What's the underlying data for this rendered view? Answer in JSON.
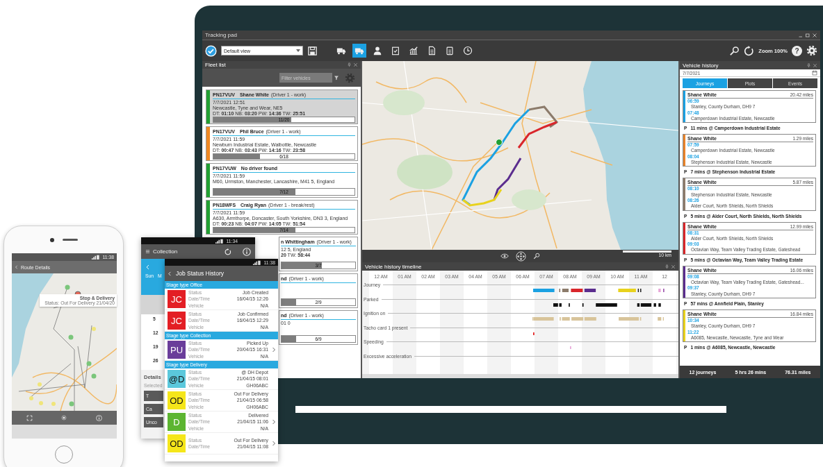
{
  "app": {
    "title": "Tracking pad",
    "view_select": "Default view",
    "zoom_label": "Zoom 100%",
    "help_label": "?",
    "toolbar_buttons": [
      {
        "selected": false
      },
      {
        "selected": true
      },
      {
        "selected": false
      },
      {
        "selected": false
      },
      {
        "selected": false
      },
      {
        "selected": false
      },
      {
        "selected": false
      },
      {
        "selected": false
      }
    ]
  },
  "fleet_list": {
    "title": "Fleet list",
    "filter_placeholder": "Filter vehicles",
    "vehicles": [
      {
        "kind": "full",
        "plate": "PN17VUV",
        "driver": "Shane White",
        "role": "(Driver 1 - work)",
        "time": "7/7/2021 12:51",
        "address": "Newcastle, Tyne and Wear, NE5",
        "stats": "DT: **01:10** NB: **03:20** PW: **14:36** TW: **25:51**",
        "progress": "11/20",
        "level": 0.55,
        "color": "#22a033",
        "selected": true
      },
      {
        "kind": "full",
        "plate": "PN17VUV",
        "driver": "Phil Bruce",
        "role": "(Driver 1 - work)",
        "time": "7/7/2021 11:59",
        "address": "Newburn Industrial Estate, Walbottle, Newcastle",
        "stats": "DT: **00:47** NB: **03:43** PW: **14:16** TW: **23:58**",
        "progress": "6/18",
        "level": 0.33,
        "color": "#f08a24",
        "selected": false
      },
      {
        "kind": "full",
        "plate": "PN17VUW",
        "driver": "No driver found",
        "time": "7/7/2021 11:59",
        "address": "M60, Urmston, Manchester, Lancashire, M41 5, England",
        "progress": "7/12",
        "level": 0.58,
        "color": "#22a033",
        "selected": false
      },
      {
        "kind": "full",
        "plate": "PN18WFS",
        "driver": "Craig Ryan",
        "role": "(Driver 1 - break/rest)",
        "time": "7/7/2021 11:59",
        "address": "A630, Armthorpe, Doncaster, South Yorkshire, DN3 3, England",
        "stats": "DT: **00:23** NB: **04:07** PW: **14:05** TW: **51:54**",
        "progress": "7/14",
        "level": 0.58,
        "color": "#22a033",
        "selected": false
      },
      {
        "kind": "partial",
        "driver": "n Whittingham",
        "role": "(Driver 1 - work)",
        "address": "12 5, England",
        "stats": "**20** TW: **58:44**",
        "progress": "3/7",
        "level": 0.55,
        "selected": false
      },
      {
        "kind": "partial",
        "driver": "nd",
        "role": "(Driver 1 - work)",
        "progress": "2/9",
        "level": 0.2,
        "selected": false
      },
      {
        "kind": "partial",
        "driver": "nd",
        "role": "(Driver 1 - work)",
        "address": "01 0",
        "progress": "6/9",
        "level": 0.2,
        "selected": false
      }
    ]
  },
  "map": {
    "scale_label": "10 km"
  },
  "timeline": {
    "title": "Vehicle history timeline",
    "hours": [
      "12 AM",
      "01 AM",
      "02 AM",
      "03 AM",
      "04 AM",
      "05 AM",
      "06 AM",
      "07 AM",
      "08 AM",
      "09 AM",
      "10 AM",
      "11 AM",
      "12"
    ],
    "rows": [
      "Journey",
      "Parked",
      "Ignition on",
      "Tacho card 1 present",
      "Speeding",
      "Excessive acceleration"
    ]
  },
  "vehicle_history": {
    "title": "Vehicle history",
    "date": "7/7/2021",
    "tabs": [
      {
        "label": "Journeys",
        "selected": true
      },
      {
        "label": "Plots",
        "selected": false
      },
      {
        "label": "Events",
        "selected": false
      }
    ],
    "items": [
      {
        "kind": "journey",
        "driver": "Shane White",
        "distance": "20.42 miles",
        "color": "#1ba1e2",
        "start_time": "06:59",
        "start_place": "Stanley, County Durham, DH9 7",
        "end_time": "07:48",
        "end_place": "Camperdown Industrial Estate, Newcastle"
      },
      {
        "kind": "stop",
        "marker": "P",
        "text": "11 mins @ Camperdown Industrial Estate"
      },
      {
        "kind": "journey",
        "driver": "Shane White",
        "distance": "1.29 miles",
        "color": "#e8832a",
        "start_time": "07:59",
        "start_place": "Camperdown Industrial Estate, Newcastle",
        "end_time": "08:04",
        "end_place": "Stephenson Industrial Estate, Newcastle"
      },
      {
        "kind": "stop",
        "marker": "P",
        "text": "7 mins @ Stephenson Industrial Estate"
      },
      {
        "kind": "journey",
        "driver": "Shane White",
        "distance": "5.87 miles",
        "color": "#8c7b6b",
        "start_time": "08:10",
        "start_place": "Stephenson Industrial Estate, Newcastle",
        "end_time": "08:26",
        "end_place": "Alder Court, North Shields, North Shields"
      },
      {
        "kind": "stop",
        "marker": "P",
        "text": "5 mins @ Alder Court, North Shields, North Shields"
      },
      {
        "kind": "journey",
        "driver": "Shane White",
        "distance": "12.99 miles",
        "color": "#d9262b",
        "start_time": "08:31",
        "start_place": "Alder Court, North Shields, North Shields",
        "end_time": "09:03",
        "end_place": "Octavian Way, Team Valley Trading Estate, Gateshead"
      },
      {
        "kind": "stop",
        "marker": "P",
        "text": "5 mins @ Octavian Way, Team Valley Trading Estate"
      },
      {
        "kind": "journey",
        "driver": "Shane White",
        "distance": "16.06 miles",
        "color": "#5b2d8e",
        "start_time": "09:08",
        "start_place": "Octavian Way, Team Valley Trading Estate, Gateshead...",
        "end_time": "09:37",
        "end_place": "Stanley, County Durham, DH9 7"
      },
      {
        "kind": "stop",
        "marker": "P",
        "text": "57 mins @ Annfield Plain, Stanley"
      },
      {
        "kind": "journey",
        "driver": "Shane White",
        "distance": "16.84 miles",
        "color": "#e8d21d",
        "start_time": "10:34",
        "start_place": "Stanley, County Durham, DH9 7",
        "end_time": "11:22",
        "end_place": "A6085, Newcastle, Newcastle, Tyne and Wear"
      },
      {
        "kind": "stop",
        "marker": "P",
        "text": "1 mins @ A6085, Newcastle, Newcastle"
      }
    ],
    "footer": [
      "12 journeys",
      "5 hrs 26 mins",
      "76.31 miles"
    ]
  },
  "route_phone": {
    "time": "11:38",
    "title": "Route Details",
    "popup_title": "Stop & Delivery",
    "popup_text": "Status: Out For Delivery 21/04/20"
  },
  "collection_phone": {
    "time": "11:34",
    "title": "Collection",
    "weekdays": [
      "Sun",
      "M"
    ],
    "dates": [
      "5",
      "12",
      "19",
      "26"
    ],
    "details_title": "Details",
    "details_label": "Selected",
    "buttons": [
      "T",
      "Ca",
      "Unco"
    ]
  },
  "job_phone": {
    "time": "11:38",
    "title": "Job Status History",
    "sections": [
      {
        "title": "Stage type Office",
        "entries": [
          {
            "badge": "JC",
            "color": "#e31e24",
            "has_details": false,
            "rows": [
              {
                "label": "Status",
                "value": "Job Created"
              },
              {
                "label": "Date/Time",
                "value": "16/04/15 12:26"
              },
              {
                "label": "Vehicle",
                "value": "N/A"
              }
            ]
          },
          {
            "badge": "JC",
            "color": "#e31e24",
            "has_details": false,
            "rows": [
              {
                "label": "Status",
                "value": "Job Confirmed"
              },
              {
                "label": "Date/Time",
                "value": "16/04/15 12:29"
              },
              {
                "label": "Vehicle",
                "value": "N/A"
              }
            ]
          }
        ]
      },
      {
        "title": "Stage type Collection",
        "entries": [
          {
            "badge": "PU",
            "color": "#6a3d9a",
            "has_details": true,
            "rows": [
              {
                "label": "Status",
                "value": "Picked Up"
              },
              {
                "label": "Date/Time",
                "value": "20/04/15 16:31"
              },
              {
                "label": "Vehicle",
                "value": "N/A"
              }
            ]
          }
        ]
      },
      {
        "title": "Stage type Delivery",
        "entries": [
          {
            "badge": "@D",
            "color": "#5bc8dc",
            "has_details": false,
            "rows": [
              {
                "label": "Status",
                "value": "@ DH Depot"
              },
              {
                "label": "Date/Time",
                "value": "21/04/15 08:01"
              },
              {
                "label": "Vehicle",
                "value": "GH06ABC"
              }
            ]
          },
          {
            "badge": "OD",
            "color": "#f5e61a",
            "has_details": false,
            "rows": [
              {
                "label": "Status",
                "value": "Out For Delivery"
              },
              {
                "label": "Date/Time",
                "value": "21/04/15 06:58"
              },
              {
                "label": "Vehicle",
                "value": "GH06ABC"
              }
            ]
          },
          {
            "badge": "D",
            "color": "#5cb531",
            "has_details": true,
            "rows": [
              {
                "label": "Status",
                "value": "Delivered"
              },
              {
                "label": "Date/Time",
                "value": "21/04/15 11:06"
              },
              {
                "label": "Vehicle",
                "value": "N/A"
              }
            ]
          },
          {
            "badge": "OD",
            "color": "#f5e61a",
            "has_details": true,
            "rows": [
              {
                "label": "Status",
                "value": "Out For Delivery"
              },
              {
                "label": "Date/Time",
                "value": "21/04/15 11:08"
              }
            ]
          }
        ]
      }
    ]
  }
}
